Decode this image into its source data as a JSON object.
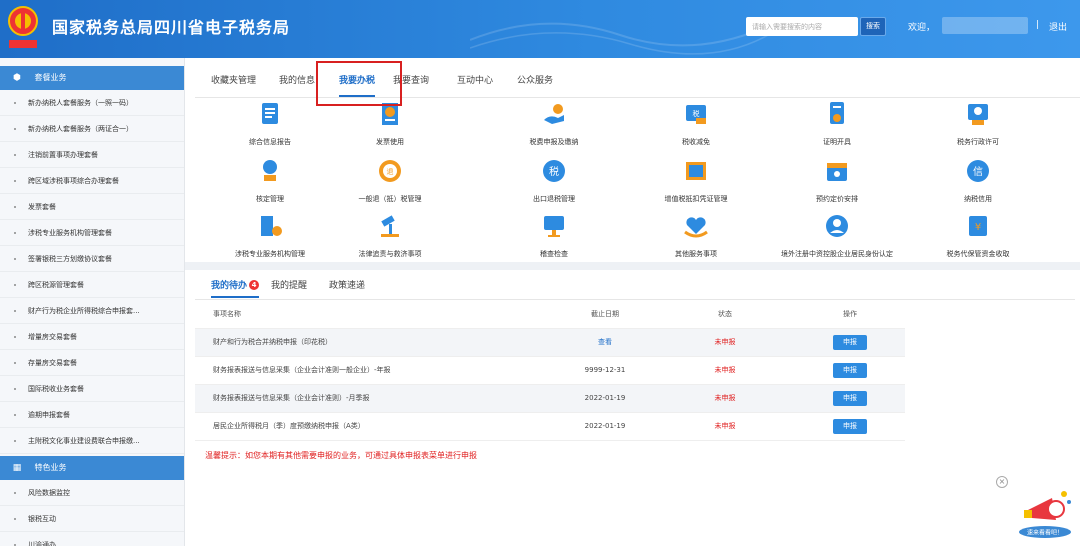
{
  "header": {
    "title": "国家税务总局四川省电子税务局",
    "emblem_caption": "中国税务",
    "search_placeholder": "请输入需要搜索的内容",
    "search_button": "搜索",
    "welcome": "欢迎，",
    "separator": "|",
    "logout": "退出"
  },
  "sidebar": {
    "section1": {
      "title": "套餐业务",
      "icon": "package-icon"
    },
    "items1": [
      "新办纳税人套餐服务（一照一码）",
      "新办纳税人套餐服务（两证合一）",
      "注销前置事项办理套餐",
      "跨区域涉税事项综合办理套餐",
      "发票套餐",
      "涉税专业服务机构管理套餐",
      "签署银税三方划缴协议套餐",
      "跨区税源管理套餐",
      "财产行为税企业所得税综合申报套...",
      "增量房交易套餐",
      "存量房交易套餐",
      "国际税收业务套餐",
      "逾期申报套餐",
      "主附税文化事业建设费联合申报缴..."
    ],
    "section2": {
      "title": "特色业务",
      "icon": "grid-icon"
    },
    "items2": [
      "风险数据监控",
      "银税互动",
      "川渝通办"
    ]
  },
  "top_tabs": [
    "收藏夹管理",
    "我的信息",
    "我要办税",
    "我要查询",
    "互动中心",
    "公众服务"
  ],
  "active_tab": "我要办税",
  "functions": [
    {
      "label": "综合信息报告",
      "icon": "report-icon"
    },
    {
      "label": "发票使用",
      "icon": "invoice-icon"
    },
    {
      "label": "税费申报及缴纳",
      "icon": "tax-payment-icon"
    },
    {
      "label": "税收减免",
      "icon": "tax-relief-icon"
    },
    {
      "label": "证明开具",
      "icon": "certificate-icon"
    },
    {
      "label": "税务行政许可",
      "icon": "admin-permit-icon"
    },
    {
      "label": "核定管理",
      "icon": "approval-icon"
    },
    {
      "label": "一般退（抵）税管理",
      "icon": "tax-refund-icon"
    },
    {
      "label": "出口退税管理",
      "icon": "export-refund-icon"
    },
    {
      "label": "增值税抵扣凭证管理",
      "icon": "vat-voucher-icon"
    },
    {
      "label": "预约定价安排",
      "icon": "calendar-icon"
    },
    {
      "label": "纳税信用",
      "icon": "credit-icon"
    },
    {
      "label": "涉税专业服务机构管理",
      "icon": "agency-icon"
    },
    {
      "label": "法律追责与救济事项",
      "icon": "gavel-icon"
    },
    {
      "label": "稽查检查",
      "icon": "inspection-icon"
    },
    {
      "label": "其他服务事项",
      "icon": "heart-hand-icon"
    },
    {
      "label": "境外注册中资控股企业居民身份认定",
      "icon": "resident-icon"
    },
    {
      "label": "税务代保管资金收取",
      "icon": "custody-fund-icon"
    }
  ],
  "todo": {
    "tabs": [
      "我的待办",
      "我的提醒",
      "政策速递"
    ],
    "badge": "4",
    "columns": [
      "事项名称",
      "截止日期",
      "状态",
      "操作"
    ],
    "rows": [
      {
        "name": "财产和行为税合并纳税申报（印花税）",
        "deadline": "查看",
        "status": "未申报",
        "action": "申报"
      },
      {
        "name": "财务报表报送与信息采集（企业会计准则一般企业）-年报",
        "deadline": "9999-12-31",
        "status": "未申报",
        "action": "申报"
      },
      {
        "name": "财务报表报送与信息采集（企业会计准则）-月季报",
        "deadline": "2022-01-19",
        "status": "未申报",
        "action": "申报"
      },
      {
        "name": "居民企业所得税月（季）度预缴纳税申报（A类）",
        "deadline": "2022-01-19",
        "status": "未申报",
        "action": "申报"
      }
    ],
    "tip": "温馨提示：如您本期有其他需要申报的业务，可通过具体申报表菜单进行申报"
  },
  "mascot": {
    "label": "速来看看吧！",
    "icon": "megaphone-icon",
    "close": "×"
  },
  "colors": {
    "primary": "#1f6ec8",
    "accent_red": "#e02020",
    "orange": "#f29a1f",
    "button": "#2d8be0"
  }
}
